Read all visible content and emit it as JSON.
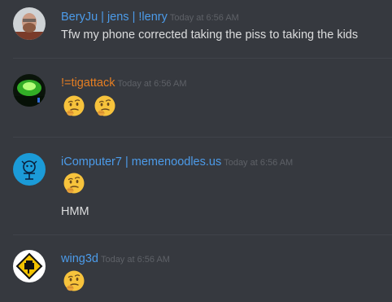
{
  "messages": [
    {
      "author": "BeryJu | jens | !lenry",
      "author_color": "#4c9be9",
      "timestamp": "Today at 6:56 AM",
      "text": "Tfw my phone corrected taking the piss to taking the kids"
    },
    {
      "author": "!=tigattack",
      "author_color": "#e67e22",
      "timestamp": "Today at 6:56 AM",
      "emojis": [
        "thinking-face",
        "thinking-face"
      ]
    },
    {
      "author": "iComputer7 | memenoodles.us",
      "author_color": "#4c9be9",
      "timestamp": "Today at 6:56 AM",
      "emojis": [
        "thinking-face"
      ],
      "text": "HMM"
    },
    {
      "author": "wing3d",
      "author_color": "#4c9be9",
      "timestamp": "Today at 6:56 AM",
      "emojis": [
        "thinking-face"
      ]
    }
  ]
}
